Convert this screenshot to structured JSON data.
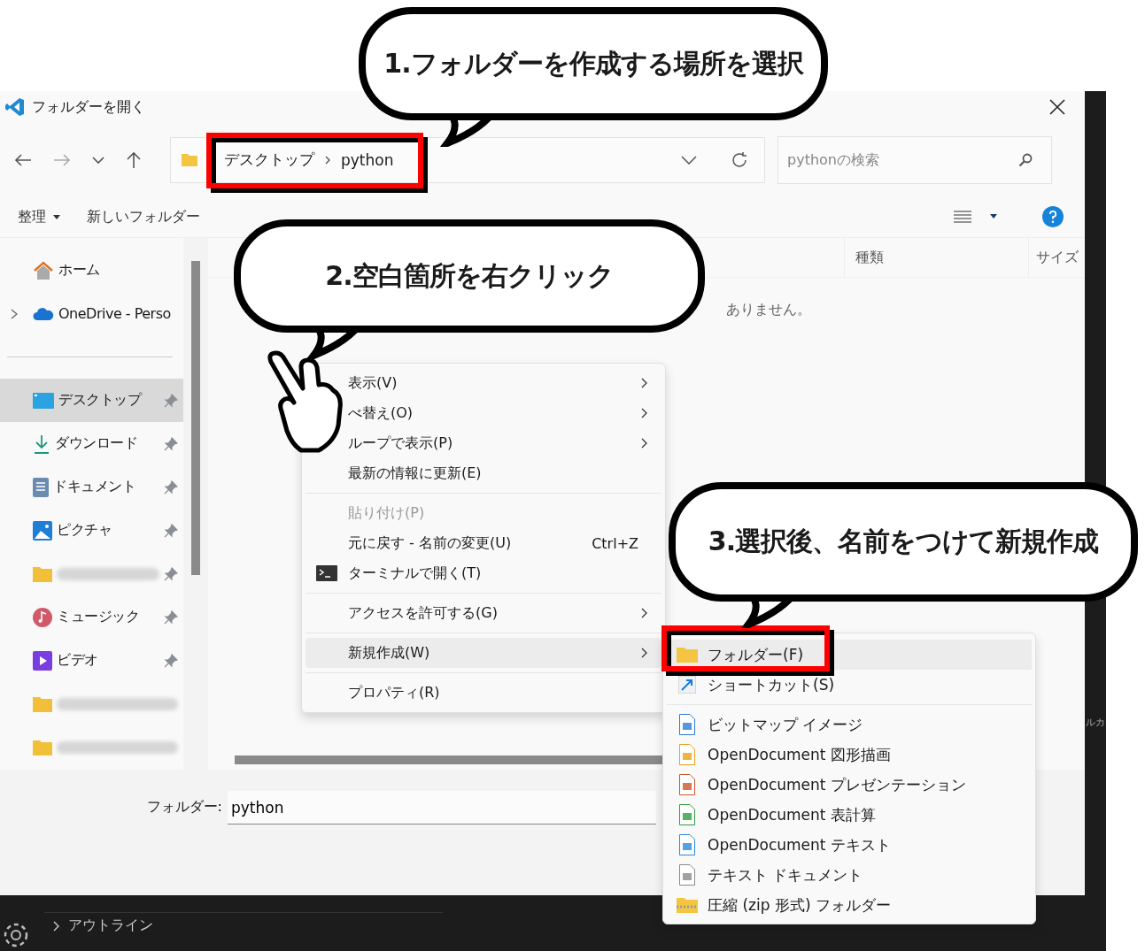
{
  "callouts": [
    {
      "text": "1.フォルダーを作成する場所を選択"
    },
    {
      "text": "2.空白箇所を右クリック"
    },
    {
      "text": "3.選択後、名前をつけて新規作成"
    }
  ],
  "window": {
    "title": "フォルダーを開く"
  },
  "address_bar": {
    "path": [
      "デスクトップ",
      "python"
    ]
  },
  "search": {
    "placeholder": "pythonの検索"
  },
  "command_bar": {
    "organize": "整理",
    "new_folder": "新しいフォルダー"
  },
  "sidebar": {
    "items": [
      {
        "kind": "home",
        "label": "ホーム",
        "pinned": false,
        "selected": false,
        "expandable": false
      },
      {
        "kind": "cloud",
        "label": "OneDrive - Perso",
        "pinned": false,
        "selected": false,
        "expandable": true
      },
      {
        "kind": "separator"
      },
      {
        "kind": "desktop",
        "label": "デスクトップ",
        "pinned": true,
        "selected": true,
        "expandable": false
      },
      {
        "kind": "download",
        "label": "ダウンロード",
        "pinned": true,
        "selected": false,
        "expandable": false
      },
      {
        "kind": "document",
        "label": "ドキュメント",
        "pinned": true,
        "selected": false,
        "expandable": false
      },
      {
        "kind": "picture",
        "label": "ピクチャ",
        "pinned": true,
        "selected": false,
        "expandable": false
      },
      {
        "kind": "folder",
        "pinned": true,
        "selected": false,
        "expandable": false
      },
      {
        "kind": "music",
        "label": "ミュージック",
        "pinned": true,
        "selected": false,
        "expandable": false
      },
      {
        "kind": "video",
        "label": "ビデオ",
        "pinned": true,
        "selected": false,
        "expandable": false
      },
      {
        "kind": "folder",
        "pinned": false,
        "selected": false,
        "expandable": false
      },
      {
        "kind": "folder",
        "pinned": false,
        "selected": false,
        "expandable": false
      }
    ]
  },
  "file_list": {
    "columns": [
      "種類",
      "サイズ"
    ],
    "empty_message": "ありません。"
  },
  "context_menu": {
    "items": [
      {
        "kind": "item",
        "label": "表示(V)",
        "submenu": true,
        "disabled": false,
        "selected": false
      },
      {
        "kind": "item",
        "label": "べ替え(O)",
        "submenu": true,
        "disabled": false,
        "selected": false
      },
      {
        "kind": "item",
        "label": "ループで表示(P)",
        "submenu": true,
        "disabled": false,
        "selected": false
      },
      {
        "kind": "item",
        "label": "最新の情報に更新(E)",
        "submenu": false,
        "disabled": false,
        "selected": false
      },
      {
        "kind": "separator"
      },
      {
        "kind": "item",
        "label": "貼り付け(P)",
        "submenu": false,
        "disabled": true,
        "selected": false
      },
      {
        "kind": "item",
        "label": "元に戻す - 名前の変更(U)",
        "shortcut": "Ctrl+Z",
        "submenu": false,
        "disabled": false,
        "selected": false
      },
      {
        "kind": "terminal",
        "label": "ターミナルで開く(T)",
        "submenu": false,
        "disabled": false,
        "selected": false
      },
      {
        "kind": "separator"
      },
      {
        "kind": "item",
        "label": "アクセスを許可する(G)",
        "submenu": true,
        "disabled": false,
        "selected": false
      },
      {
        "kind": "separator"
      },
      {
        "kind": "item",
        "label": "新規作成(W)",
        "submenu": true,
        "disabled": false,
        "selected": true
      },
      {
        "kind": "separator"
      },
      {
        "kind": "item",
        "label": "プロパティ(R)",
        "submenu": false,
        "disabled": false,
        "selected": false
      }
    ]
  },
  "new_submenu": {
    "items": [
      {
        "kind": "folder",
        "label": "フォルダー(F)",
        "selected": true
      },
      {
        "kind": "shortcut",
        "label": "ショートカット(S)",
        "selected": false
      },
      {
        "kind": "separator"
      },
      {
        "kind": "bitmap",
        "label": "ビットマップ イメージ",
        "selected": false
      },
      {
        "kind": "odg",
        "label": "OpenDocument 図形描画",
        "selected": false
      },
      {
        "kind": "odp",
        "label": "OpenDocument プレゼンテーション",
        "selected": false
      },
      {
        "kind": "ods",
        "label": "OpenDocument 表計算",
        "selected": false
      },
      {
        "kind": "odt",
        "label": "OpenDocument テキスト",
        "selected": false
      },
      {
        "kind": "txt",
        "label": "テキスト ドキュメント",
        "selected": false
      },
      {
        "kind": "zip",
        "label": "圧縮 (zip 形式) フォルダー",
        "selected": false
      }
    ]
  },
  "folder_field": {
    "label": "フォルダー:",
    "value": "python"
  },
  "background_app": {
    "fragment": "ルカ",
    "panel_items": [
      "アウトライン"
    ]
  }
}
